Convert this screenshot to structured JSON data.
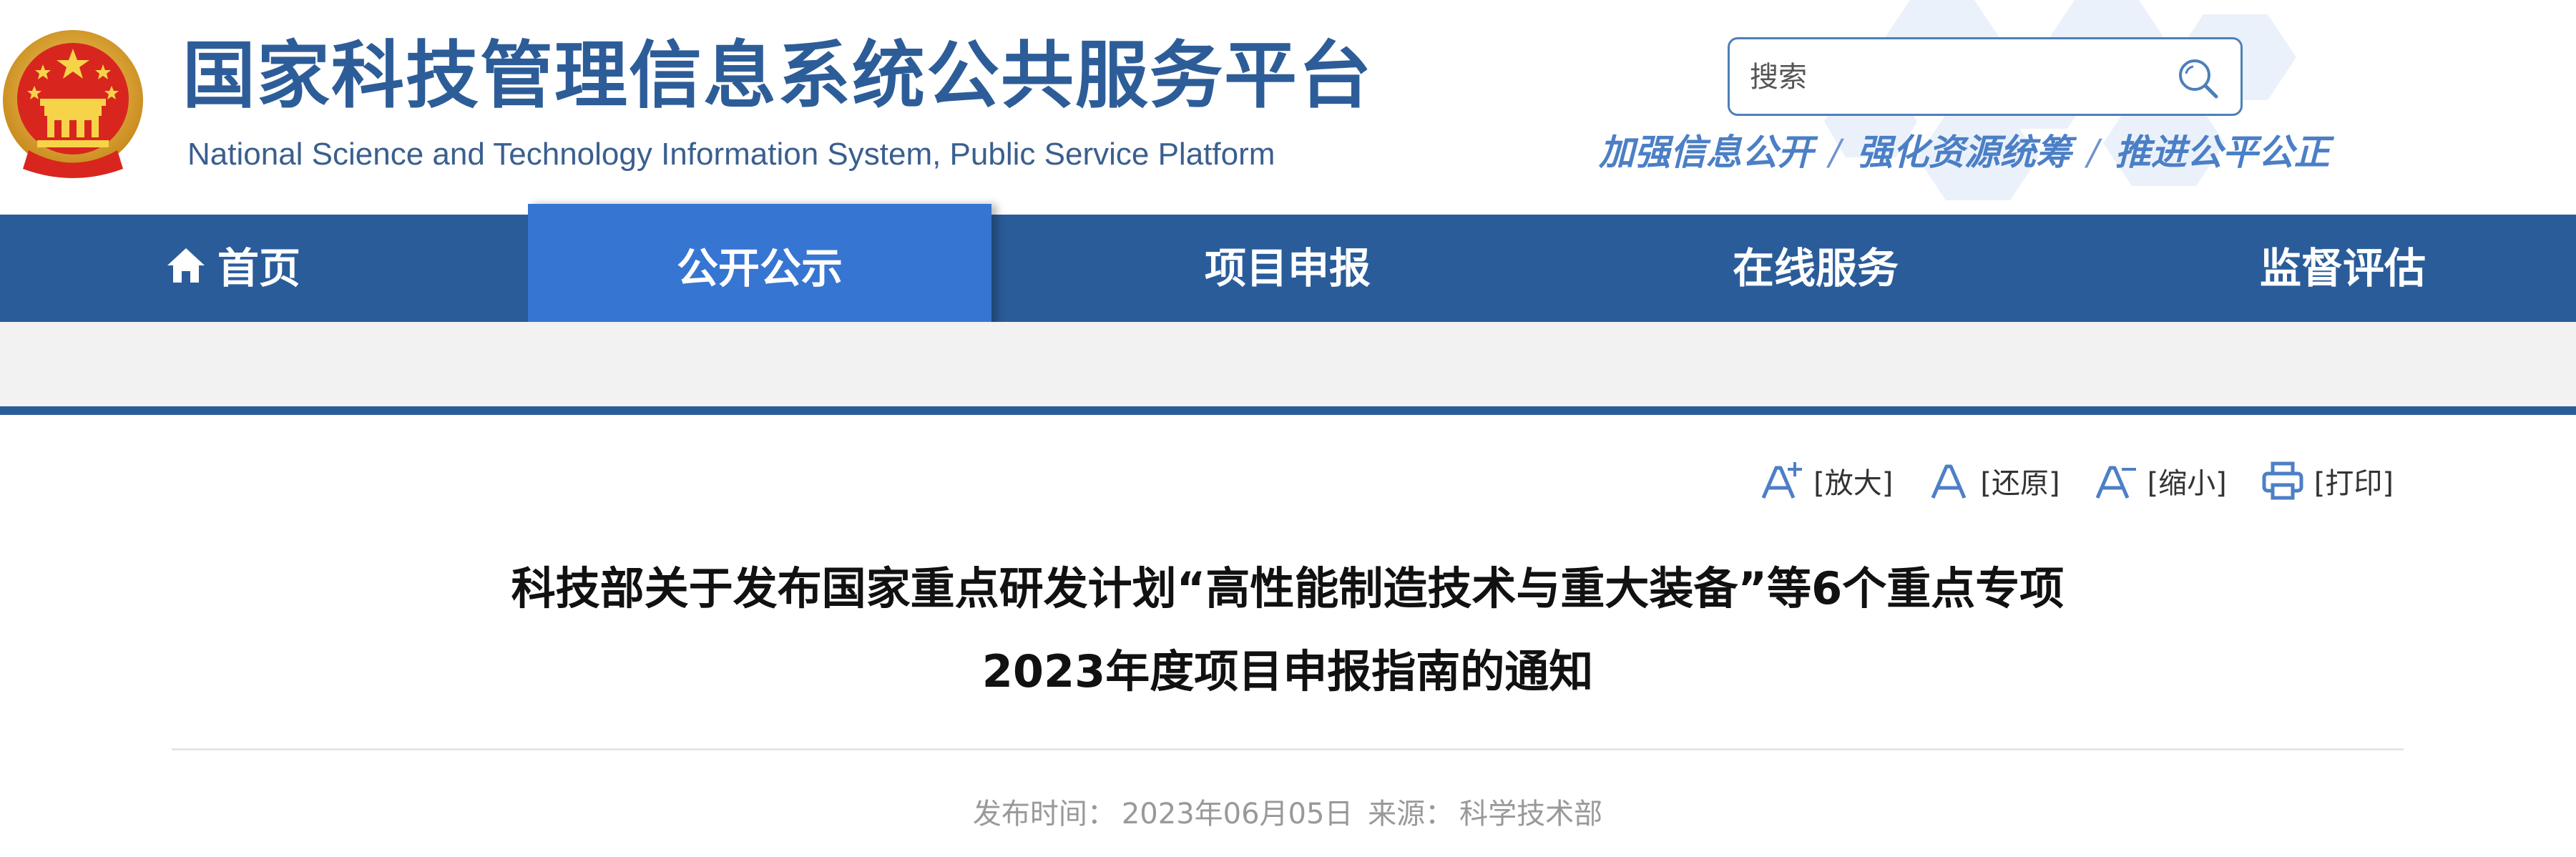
{
  "header": {
    "title": "国家科技管理信息系统公共服务平台",
    "subtitle": "National Science and Technology Information System, Public Service Platform",
    "search": {
      "placeholder": "搜索",
      "value": ""
    },
    "slogan": [
      "加强信息公开",
      "/",
      "强化资源统筹",
      "/",
      "推进公平公正"
    ]
  },
  "nav": {
    "items": [
      {
        "label": "首页",
        "icon": "home-icon"
      },
      {
        "label": "公开公示",
        "active": true
      },
      {
        "label": "项目申报"
      },
      {
        "label": "在线服务"
      },
      {
        "label": "监督评估"
      }
    ]
  },
  "tools": {
    "enlarge": "[放大]",
    "restore": "[还原]",
    "shrink": "[缩小]",
    "print": "[打印]"
  },
  "article": {
    "title_line1": "科技部关于发布国家重点研发计划“高性能制造技术与重大装备”等6个重点专项",
    "title_line2": "2023年度项目申报指南的通知",
    "meta": {
      "date_label": "发布时间：",
      "date": "2023年06月05日",
      "source_label": "来源：",
      "source": "科学技术部"
    }
  },
  "colors": {
    "brand_blue": "#2a5c9a",
    "active_blue": "#3675d2",
    "title_blue": "#2d5d98",
    "slogan_blue": "#4b7fc6"
  }
}
